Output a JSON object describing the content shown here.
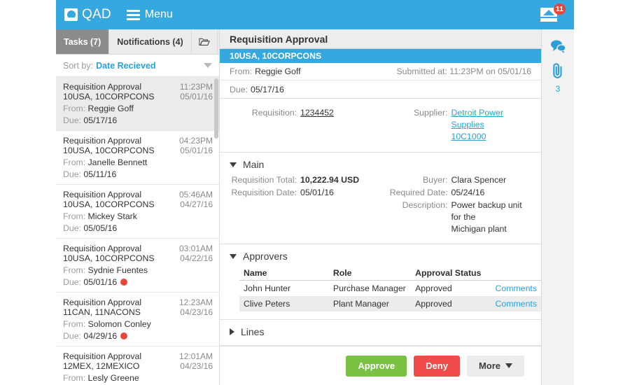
{
  "header": {
    "brand": "QAD",
    "brand_icon": "qad-logo-icon",
    "menu_label": "Menu",
    "menu_icon": "hamburger-icon",
    "inbox_icon": "inbox-tray-icon",
    "inbox_badge": "11",
    "accent_color": "#35A8E0",
    "badge_color": "#E8453C"
  },
  "tabs": {
    "tasks_label": "Tasks (7)",
    "notifications_label": "Notifications (4)",
    "folder_icon": "open-folder-icon"
  },
  "sort": {
    "label": "Sort by:",
    "value": "Date Recieved",
    "caret_icon": "chevron-down-icon"
  },
  "tasks": [
    {
      "title": "Requisition Approval",
      "org": "10USA, 10CORPCONS",
      "time": "11:23PM",
      "date": "05/01/16",
      "from_label": "From:",
      "from": "Reggie Goff",
      "due_label": "Due:",
      "due": "05/17/16",
      "overdue": false,
      "selected": true
    },
    {
      "title": "Requisition Approval",
      "org": "10USA, 10CORPCONS",
      "time": "04:23PM",
      "date": "05/01/16",
      "from_label": "From:",
      "from": "Janelle Bennett",
      "due_label": "Due:",
      "due": "05/11/16",
      "overdue": false,
      "selected": false
    },
    {
      "title": "Requisition Approval",
      "org": "10USA, 10CORPCONS",
      "time": "05:46AM",
      "date": "04/27/16",
      "from_label": "From:",
      "from": "Mickey Stark",
      "due_label": "Due:",
      "due": "05/05/16",
      "overdue": false,
      "selected": false
    },
    {
      "title": "Requisition Approval",
      "org": "10USA, 10CORPCONS",
      "time": "03:01AM",
      "date": "04/22/16",
      "from_label": "From:",
      "from": "Sydnie Fuentes",
      "due_label": "Due:",
      "due": "05/01/16",
      "overdue": true,
      "selected": false
    },
    {
      "title": "Requisition Approval",
      "org": "11CAN, 11NACONS",
      "time": "12:23AM",
      "date": "04/23/16",
      "from_label": "From:",
      "from": "Solomon Conley",
      "due_label": "Due:",
      "due": "04/29/16",
      "overdue": true,
      "selected": false
    },
    {
      "title": "Requisition Approval",
      "org": "12MEX, 12MEXICO",
      "time": "12:01AM",
      "date": "04/23/16",
      "from_label": "From:",
      "from": "Lesly Greene",
      "due_label": "",
      "due": "",
      "overdue": false,
      "selected": false
    }
  ],
  "detail": {
    "title": "Requisition Approval",
    "org": "10USA, 10CORPCONS",
    "from_label": "From:",
    "from": "Reggie Goff",
    "submitted": "Submitted at: 11:23PM on 05/01/16",
    "due_label": "Due:",
    "due": "05/17/16",
    "requisition_label": "Requisition:",
    "requisition_value": "1234452",
    "supplier_label": "Supplier:",
    "supplier_value_line1": "Detroit Power Supplies",
    "supplier_value_line2": "10C1000"
  },
  "main_section": {
    "title": "Main",
    "caret_icon": "caret-down-icon",
    "fields": {
      "requisition_total_label": "Requisition Total:",
      "requisition_total": "10,222.94 USD",
      "requisition_date_label": "Requisition Date:",
      "requisition_date": "05/01/16",
      "buyer_label": "Buyer:",
      "buyer": "Clara Spencer",
      "required_date_label": "Required Date:",
      "required_date": "05/24/16",
      "description_label": "Description:",
      "description_line1": "Power backup unit for the",
      "description_line2": "Michigan plant"
    }
  },
  "approvers_section": {
    "title": "Approvers",
    "caret_icon": "caret-down-icon",
    "columns": [
      "Name",
      "Role",
      "Approval Status",
      ""
    ],
    "rows": [
      {
        "name": "John Hunter",
        "role": "Purchase Manager",
        "status": "Approved",
        "comments": "Comments"
      },
      {
        "name": "Clive Peters",
        "role": "Plant Manager",
        "status": "Approved",
        "comments": "Comments"
      }
    ]
  },
  "lines_section": {
    "title": "Lines",
    "caret_icon": "caret-right-icon"
  },
  "actions": {
    "approve": "Approve",
    "deny": "Deny",
    "more": "More",
    "more_caret_icon": "caret-down-icon",
    "approve_color": "#7AC143",
    "deny_color": "#F04B4B"
  },
  "rail": {
    "comments_icon": "speech-bubbles-icon",
    "attachment_icon": "paperclip-icon",
    "attachment_count": "3"
  }
}
